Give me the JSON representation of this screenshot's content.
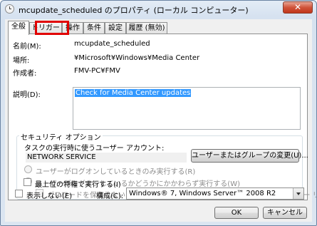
{
  "window": {
    "title": "mcupdate_scheduled のプロパティ (ローカル コンピューター)",
    "close_glyph": "✕"
  },
  "tabs": [
    {
      "label": "全般"
    },
    {
      "label": "トリガー"
    },
    {
      "label": "操作"
    },
    {
      "label": "条件"
    },
    {
      "label": "設定"
    },
    {
      "label": "履歴 (無効)"
    }
  ],
  "general": {
    "name_label": "名前(M):",
    "name_value": "mcupdate_scheduled",
    "location_label": "場所:",
    "location_value": "¥Microsoft¥Windows¥Media Center",
    "author_label": "作成者:",
    "author_value": "FMV-PC¥FMV",
    "description_label": "説明(D):",
    "description_value": "Check for Media Center updates"
  },
  "security": {
    "group_title": "セキュリティ オプション",
    "account_prompt": "タスクの実行時に使うユーザー アカウント:",
    "account_value": "NETWORK SERVICE",
    "change_button": "ユーザーまたはグループの変更(U)...",
    "radio_logged_on": "ユーザーがログオンしているときのみ実行する(R)",
    "radio_whether": "ユーザーがログオンしているかどうかにかかわらず実行する(W)",
    "no_store_password": "パスワードを保存しない (P)タスクがアクセスできるのはローカル コンピューター リソースのみ",
    "highest_privileges": "最上位の特権で実行する(I)"
  },
  "footer": {
    "hidden_label": "表示しない(E)",
    "configure_label": "構成(C):",
    "configure_value": "Windows® 7, Windows Server™ 2008 R2",
    "ok": "OK",
    "cancel": "キャンセル"
  }
}
